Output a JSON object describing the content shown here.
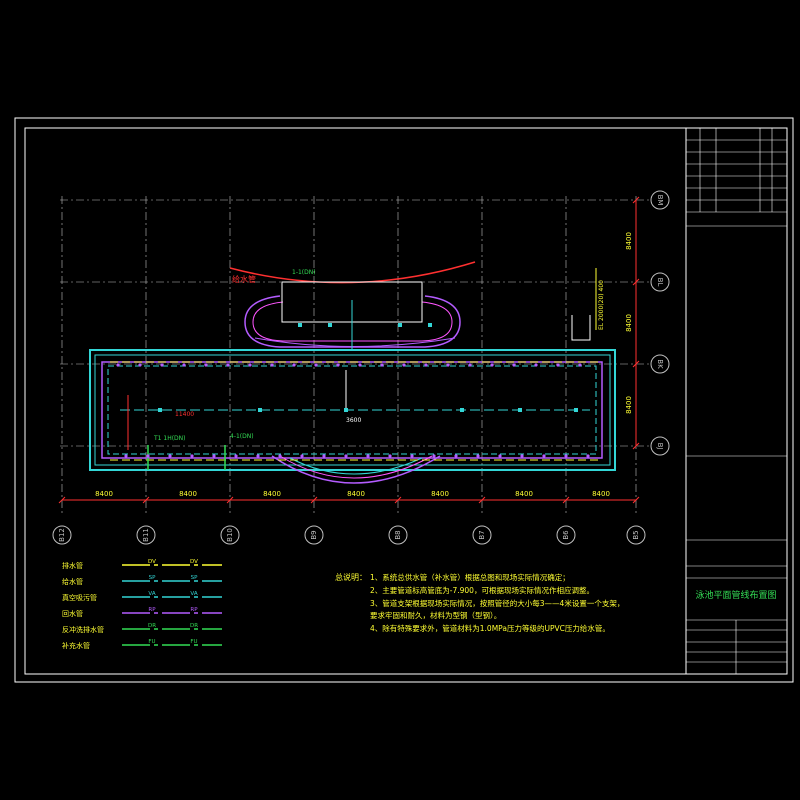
{
  "colors": {
    "background": "#000000",
    "frame": "#ffffff",
    "grid": "#bfbfbf",
    "dim": "#ff3030",
    "pool_outer": "#33d6d6",
    "pool_inner": "#b45cff",
    "pipe_green": "#33dd55",
    "notes": "#ffff33",
    "label_yellow": "#ffff33",
    "red": "#ff3030"
  },
  "axes": {
    "horizontal_labels": [
      "B12",
      "B11",
      "B10",
      "B9",
      "B8",
      "B7",
      "B6",
      "B5"
    ],
    "vertical_labels": [
      "BM",
      "BL",
      "BK",
      "BJ"
    ],
    "spacing_h": [
      "8400",
      "8400",
      "8400",
      "8400",
      "8400",
      "8400",
      "8400"
    ],
    "spacing_v": [
      "8400",
      "8400",
      "8400"
    ]
  },
  "legend": [
    {
      "label": "排水管",
      "code": "DV",
      "color": "#ffff33"
    },
    {
      "label": "给水管",
      "code": "SP",
      "color": "#33d6d6"
    },
    {
      "label": "真空吸污管",
      "code": "VA",
      "color": "#33d6d6"
    },
    {
      "label": "回水管",
      "code": "RP",
      "color": "#b45cff"
    },
    {
      "label": "反冲洗排水管",
      "code": "DR",
      "color": "#33dd55"
    },
    {
      "label": "补充水管",
      "code": "FU",
      "color": "#33dd55"
    }
  ],
  "notes": {
    "title": "总说明：",
    "items": [
      "1、系统总供水管（补水管）根据总图和现场实际情况确定；",
      "2、主要管道标高管底为-7.900，可根据现场实际情况作相应调整。",
      "3、管道支架根据现场实际情况，按照管径的大小每3——4米设置一个支架，",
      "   要求牢固和耐久，材料为型钢（型钢）。",
      "4、除有特殊要求外，管道材料为1.0MPa压力等级的UPVC压力给水管。"
    ]
  },
  "labels": {
    "drawing_title": "泳池平面管线布置图",
    "red_label": "给水管",
    "elevation": "EL 2000(20) 400",
    "plan_note_1": "T1 1H(DN)",
    "plan_note_2": "4-1(DN)",
    "plan_note_3": "1-1(DN)",
    "dim_1": "11400",
    "dim_2": "3600"
  }
}
